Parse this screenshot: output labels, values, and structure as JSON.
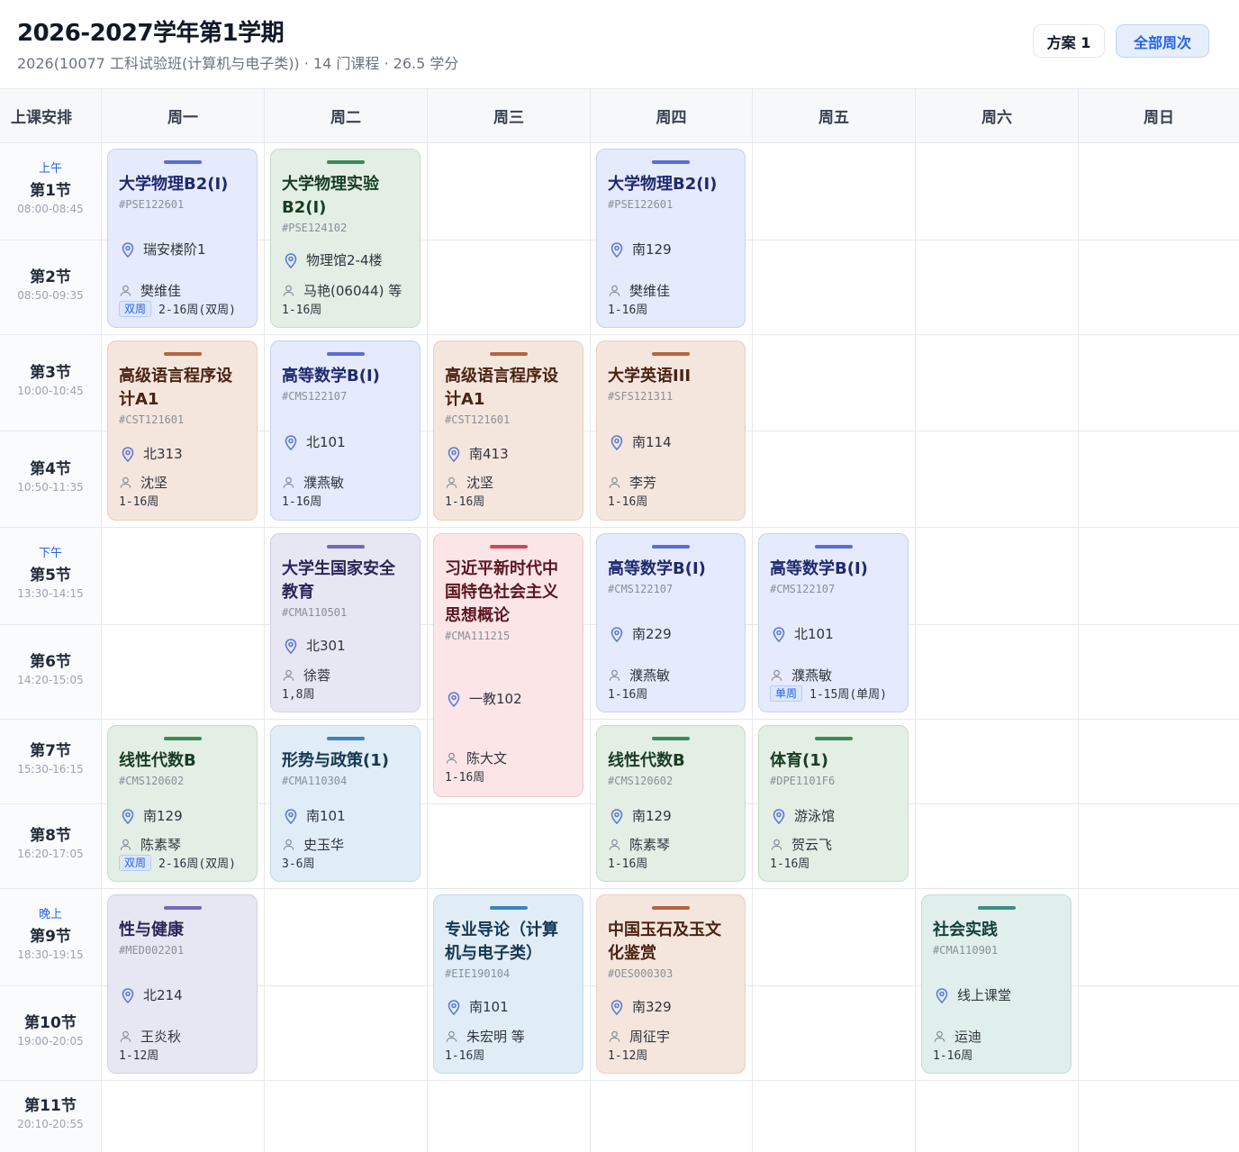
{
  "header": {
    "title": "2026-2027学年第1学期",
    "subtitle": "2026(10077 工科试验班(计算机与电子类)) · 14 门课程 · 26.5 学分",
    "plan_button": "方案 1",
    "weeks_button": "全部周次"
  },
  "grid": {
    "corner_label": "上课安排",
    "days": [
      "周一",
      "周二",
      "周三",
      "周四",
      "周五",
      "周六",
      "周日"
    ]
  },
  "periods": [
    {
      "segment": "上午",
      "name": "第1节",
      "time": "08:00-08:45"
    },
    {
      "segment": "",
      "name": "第2节",
      "time": "08:50-09:35"
    },
    {
      "segment": "",
      "name": "第3节",
      "time": "10:00-10:45"
    },
    {
      "segment": "",
      "name": "第4节",
      "time": "10:50-11:35"
    },
    {
      "segment": "下午",
      "name": "第5节",
      "time": "13:30-14:15"
    },
    {
      "segment": "",
      "name": "第6节",
      "time": "14:20-15:05"
    },
    {
      "segment": "",
      "name": "第7节",
      "time": "15:30-16:15"
    },
    {
      "segment": "",
      "name": "第8节",
      "time": "16:20-17:05"
    },
    {
      "segment": "晚上",
      "name": "第9节",
      "time": "18:30-19:15"
    },
    {
      "segment": "",
      "name": "第10节",
      "time": "19:00-20:05"
    },
    {
      "segment": "",
      "name": "第11节",
      "time": "20:10-20:55"
    }
  ],
  "courses": [
    {
      "id": "mon-physics",
      "name": "大学物理B2(I)",
      "code": "#PSE122601",
      "location": "瑞安楼阶1",
      "teacher": "樊维佳",
      "tag": "双周",
      "weeks": "2-16周(双周)"
    },
    {
      "id": "tue-physics-lab",
      "name": "大学物理实验B2(I)",
      "code": "#PSE124102",
      "location": "物理馆2-4楼",
      "teacher": "马艳(06044) 等",
      "tag": "",
      "weeks": "1-16周"
    },
    {
      "id": "thu-physics",
      "name": "大学物理B2(I)",
      "code": "#PSE122601",
      "location": "南129",
      "teacher": "樊维佳",
      "tag": "",
      "weeks": "1-16周"
    },
    {
      "id": "mon-programming",
      "name": "高级语言程序设计A1",
      "code": "#CST121601",
      "location": "北313",
      "teacher": "沈坚",
      "tag": "",
      "weeks": "1-16周"
    },
    {
      "id": "tue-math",
      "name": "高等数学B(I)",
      "code": "#CMS122107",
      "location": "北101",
      "teacher": "濮燕敏",
      "tag": "",
      "weeks": "1-16周"
    },
    {
      "id": "wed-programming",
      "name": "高级语言程序设计A1",
      "code": "#CST121601",
      "location": "南413",
      "teacher": "沈坚",
      "tag": "",
      "weeks": "1-16周"
    },
    {
      "id": "thu-english",
      "name": "大学英语III",
      "code": "#SFS121311",
      "location": "南114",
      "teacher": "李芳",
      "tag": "",
      "weeks": "1-16周"
    },
    {
      "id": "tue-security",
      "name": "大学生国家安全教育",
      "code": "#CMA110501",
      "location": "北301",
      "teacher": "徐蓉",
      "tag": "",
      "weeks": "1,8周"
    },
    {
      "id": "wed-xi",
      "name": "习近平新时代中国特色社会主义思想概论",
      "code": "#CMA111215",
      "location": "一教102",
      "teacher": "陈大文",
      "tag": "",
      "weeks": "1-16周"
    },
    {
      "id": "thu-math",
      "name": "高等数学B(I)",
      "code": "#CMS122107",
      "location": "南229",
      "teacher": "濮燕敏",
      "tag": "",
      "weeks": "1-16周"
    },
    {
      "id": "fri-math",
      "name": "高等数学B(I)",
      "code": "#CMS122107",
      "location": "北101",
      "teacher": "濮燕敏",
      "tag": "单周",
      "weeks": "1-15周(单周)"
    },
    {
      "id": "mon-linear",
      "name": "线性代数B",
      "code": "#CMS120602",
      "location": "南129",
      "teacher": "陈素琴",
      "tag": "双周",
      "weeks": "2-16周(双周)"
    },
    {
      "id": "tue-policy",
      "name": "形势与政策(1)",
      "code": "#CMA110304",
      "location": "南101",
      "teacher": "史玉华",
      "tag": "",
      "weeks": "3-6周"
    },
    {
      "id": "thu-linear",
      "name": "线性代数B",
      "code": "#CMS120602",
      "location": "南129",
      "teacher": "陈素琴",
      "tag": "",
      "weeks": "1-16周"
    },
    {
      "id": "fri-pe",
      "name": "体育(1)",
      "code": "#DPE1101F6",
      "location": "游泳馆",
      "teacher": "贺云飞",
      "tag": "",
      "weeks": "1-16周"
    },
    {
      "id": "mon-health",
      "name": "性与健康",
      "code": "#MED002201",
      "location": "北214",
      "teacher": "王炎秋",
      "tag": "",
      "weeks": "1-12周"
    },
    {
      "id": "wed-intro",
      "name": "专业导论（计算机与电子类）",
      "code": "#EIE190104",
      "location": "南101",
      "teacher": "朱宏明 等",
      "tag": "",
      "weeks": "1-16周"
    },
    {
      "id": "thu-jade",
      "name": "中国玉石及玉文化鉴赏",
      "code": "#OES000303",
      "location": "南329",
      "teacher": "周征宇",
      "tag": "",
      "weeks": "1-12周"
    },
    {
      "id": "sat-practice",
      "name": "社会实践",
      "code": "#CMA110901",
      "location": "线上课堂",
      "teacher": "运迪",
      "tag": "",
      "weeks": "1-16周"
    }
  ],
  "colors": {
    "accent": "#2563eb",
    "blue": "#5a6ed1",
    "green": "#3b8a55",
    "orange": "#b5653f",
    "purple": "#7469b6",
    "pink": "#c84a5c",
    "lightblue": "#3d86b6",
    "teal": "#3f8d86"
  },
  "icons": {
    "location": "map-pin-icon",
    "teacher": "user-icon"
  }
}
